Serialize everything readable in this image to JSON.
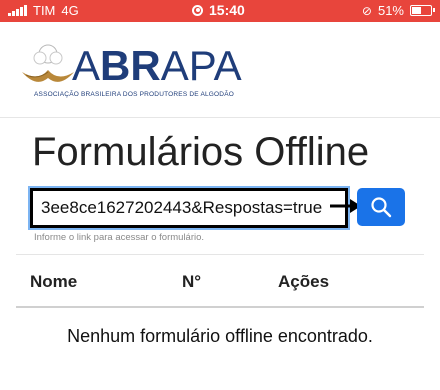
{
  "status_bar": {
    "carrier": "TIM",
    "network": "4G",
    "time": "15:40",
    "battery": "51%",
    "battery_level": 0.51,
    "color": "#e8453c"
  },
  "header": {
    "logo_text_regular": "A",
    "logo_text_bold": "BR",
    "logo_text_rest": "APA",
    "logo_subtitle": "ASSOCIAÇÃO BRASILEIRA DOS PRODUTORES DE ALGODÃO",
    "brand_color": "#1f3d7a"
  },
  "page": {
    "title": "Formulários Offline"
  },
  "search": {
    "value": "3ee8ce1627202443&Respostas=true",
    "hint": "Informe o link para acessar o formulário.",
    "button_color": "#1a73e8",
    "button_icon": "search-icon"
  },
  "table": {
    "columns": [
      "Nome",
      "N°",
      "Ações"
    ],
    "rows": [],
    "empty_message": "Nenhum formulário offline encontrado."
  }
}
